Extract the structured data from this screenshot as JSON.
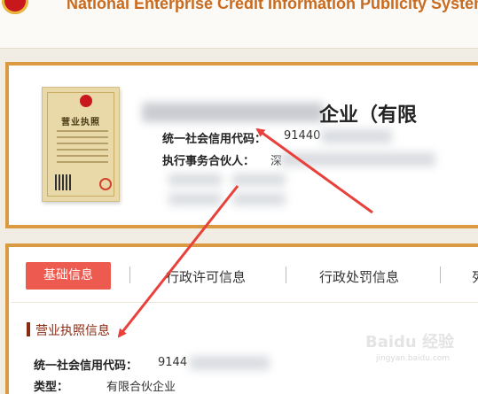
{
  "header": {
    "title": "National Enterprise Credit Information Publicity System"
  },
  "company": {
    "name_visible": "企业（有限",
    "license_thumbnail_title": "营业执照",
    "credit_code_label": "统一社会信用代码：",
    "credit_code_value": "91440",
    "partner_label": "执行事务合伙人：",
    "partner_value": "深"
  },
  "tabs": [
    {
      "label": "基础信息",
      "active": true
    },
    {
      "label": "行政许可信息",
      "active": false
    },
    {
      "label": "行政处罚信息",
      "active": false
    },
    {
      "label": "列",
      "active": false
    }
  ],
  "license_section": {
    "title": "营业执照信息",
    "credit_code_label": "统一社会信用代码：",
    "credit_code_value": "9144",
    "type_label": "类型：",
    "type_value": "有限合伙企业"
  },
  "watermark": {
    "text": "Baidu 经验",
    "sub": "jingyan.baidu.com"
  },
  "colors": {
    "accent": "#d99a41",
    "tab_active": "#ec5a50",
    "section": "#8b2a12",
    "arrow": "#e8413b"
  },
  "icons": [
    "national-emblem-icon",
    "license-thumbnail-image",
    "red-arrow-icon"
  ]
}
